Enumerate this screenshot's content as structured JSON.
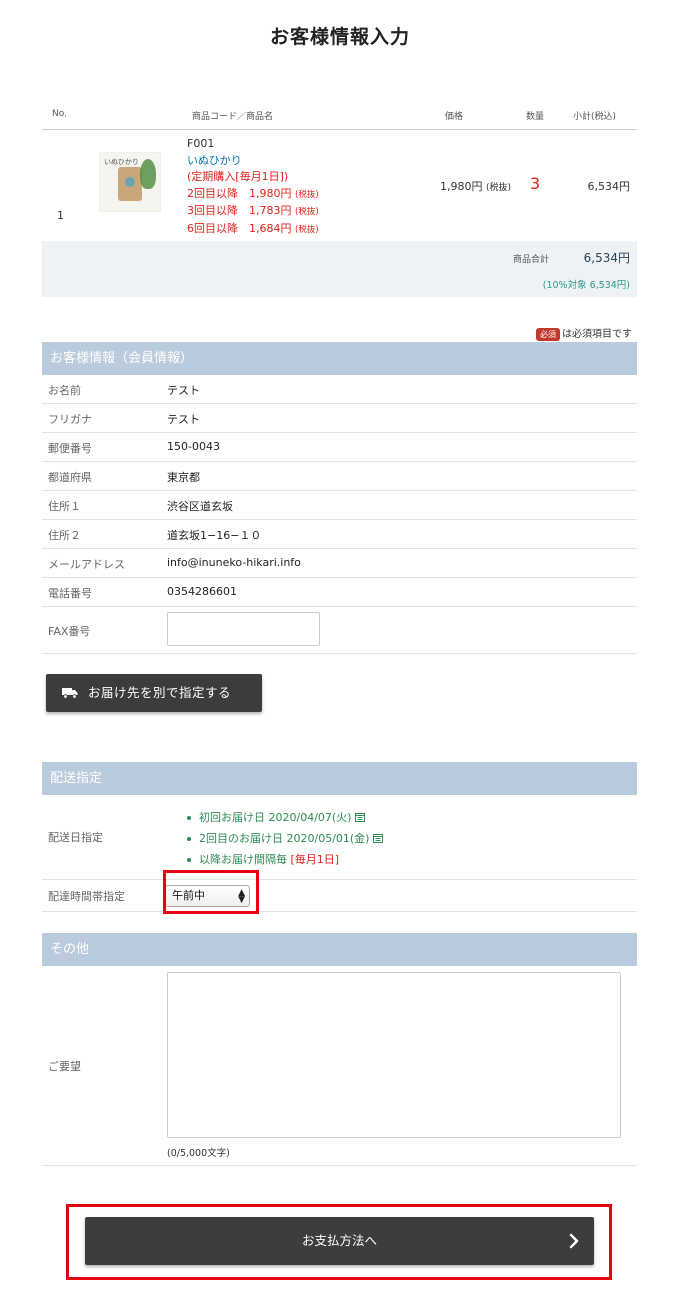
{
  "page": {
    "title": "お客様情報入力"
  },
  "cart": {
    "headers": {
      "no": "No.",
      "product": "商品コード／商品名",
      "price": "価格",
      "qty": "数量",
      "subtotal": "小計(税込)"
    },
    "item": {
      "no": "1",
      "thumb_brand": "いぬひかり",
      "code": "F001",
      "name": "いぬひかり",
      "plan": "(定期購入[毎月1日])",
      "tier1_label": "2回目以降　1,980円",
      "tier2_label": "3回目以降　1,783円",
      "tier3_label": "6回目以降　1,684円",
      "tax_excl": "(税抜)",
      "price": "1,980円",
      "qty": "3",
      "subtotal": "6,534円"
    },
    "total_label": "商品合計",
    "total_value": "6,534円",
    "tax_note": "(10%対象 6,534円)"
  },
  "required_note": {
    "badge": "必須",
    "text": "は必須項目です"
  },
  "customer": {
    "heading": "お客様情報（会員情報）",
    "rows": [
      {
        "label": "お名前",
        "value": "テスト"
      },
      {
        "label": "フリガナ",
        "value": "テスト"
      },
      {
        "label": "郵便番号",
        "value": "150-0043"
      },
      {
        "label": "都道府県",
        "value": "東京都"
      },
      {
        "label": "住所１",
        "value": "渋谷区道玄坂"
      },
      {
        "label": "住所２",
        "value": "道玄坂1−16−１０"
      },
      {
        "label": "メールアドレス",
        "value": "info@inuneko-hikari.info"
      },
      {
        "label": "電話番号",
        "value": "0354286601"
      }
    ],
    "fax_label": "FAX番号",
    "fax_value": ""
  },
  "ship_other_button": "お届け先を別で指定する",
  "delivery": {
    "heading": "配送指定",
    "date_label": "配送日指定",
    "first_date": "初回お届け日  2020/04/07(火)",
    "second_date": "2回目のお届け日  2020/05/01(金)",
    "interval_prefix": "以降お届け間隔毎",
    "interval_value": "[毎月1日]",
    "time_label": "配達時間帯指定",
    "time_selected": "午前中"
  },
  "other": {
    "heading": "その他",
    "request_label": "ご要望",
    "request_value": "",
    "counter": "(0/5,000文字)"
  },
  "pay_button": "お支払方法へ",
  "colors": {
    "section_header": "#b9cbdc",
    "accent_red": "#e0241b",
    "link_blue": "#0077b3",
    "green": "#2e8b57",
    "button_dark": "#3d3d3d"
  }
}
